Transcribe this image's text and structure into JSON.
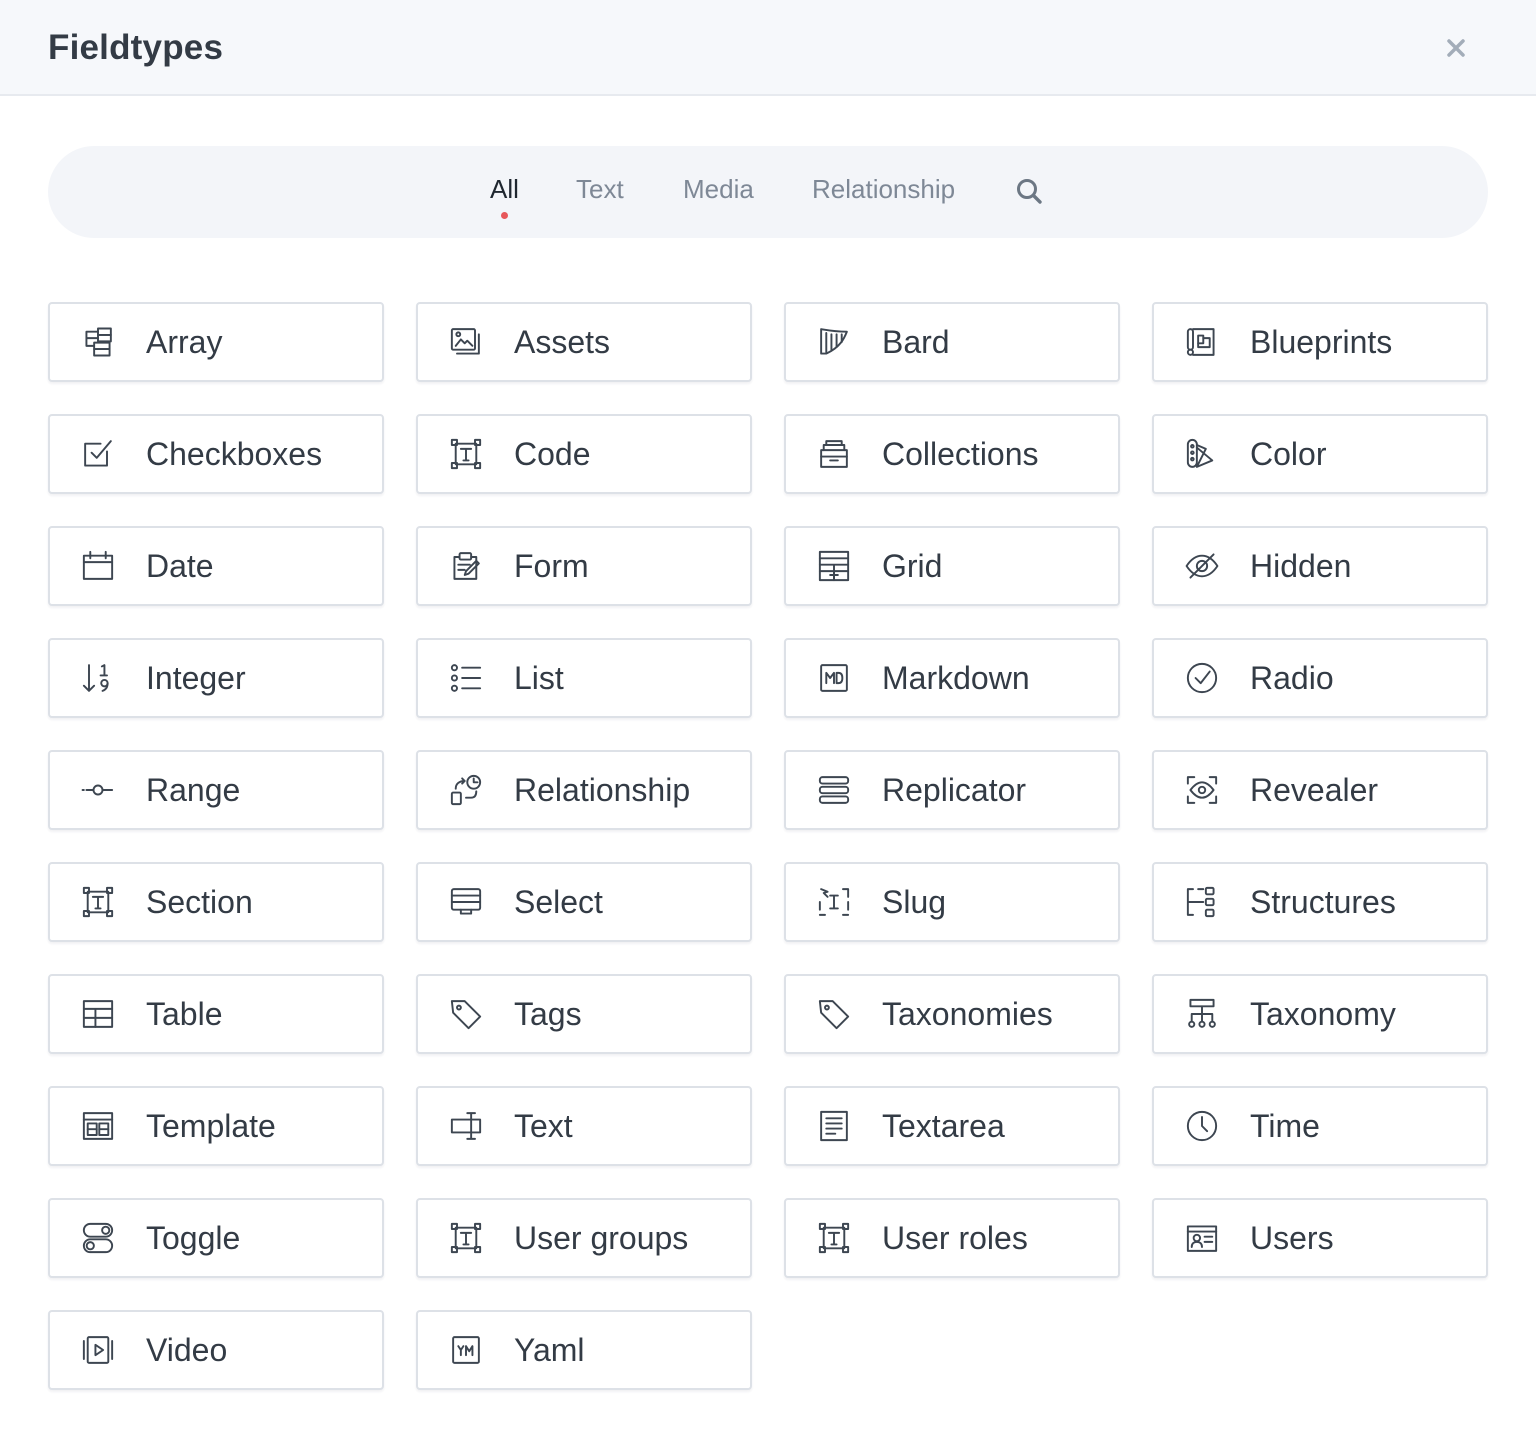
{
  "window": {
    "title": "Fieldtypes",
    "close_icon": "close-icon"
  },
  "tabs": [
    {
      "label": "All",
      "active": true
    },
    {
      "label": "Text",
      "active": false
    },
    {
      "label": "Media",
      "active": false
    },
    {
      "label": "Relationship",
      "active": false
    }
  ],
  "search_icon": "search-icon",
  "colors": {
    "active_dot": "#e7575b",
    "header_bg": "#f6f8fb",
    "tabbar_bg": "#f3f5f9",
    "card_border": "#dde1e7",
    "icon_stroke": "#3d4651"
  },
  "fieldtypes": [
    {
      "label": "Array",
      "icon": "array-icon"
    },
    {
      "label": "Assets",
      "icon": "assets-icon"
    },
    {
      "label": "Bard",
      "icon": "bard-icon"
    },
    {
      "label": "Blueprints",
      "icon": "blueprints-icon"
    },
    {
      "label": "Checkboxes",
      "icon": "checkboxes-icon"
    },
    {
      "label": "Code",
      "icon": "code-icon"
    },
    {
      "label": "Collections",
      "icon": "collections-icon"
    },
    {
      "label": "Color",
      "icon": "color-icon"
    },
    {
      "label": "Date",
      "icon": "date-icon"
    },
    {
      "label": "Form",
      "icon": "form-icon"
    },
    {
      "label": "Grid",
      "icon": "grid-icon"
    },
    {
      "label": "Hidden",
      "icon": "hidden-icon"
    },
    {
      "label": "Integer",
      "icon": "integer-icon"
    },
    {
      "label": "List",
      "icon": "list-icon"
    },
    {
      "label": "Markdown",
      "icon": "markdown-icon"
    },
    {
      "label": "Radio",
      "icon": "radio-icon"
    },
    {
      "label": "Range",
      "icon": "range-icon"
    },
    {
      "label": "Relationship",
      "icon": "relationship-icon"
    },
    {
      "label": "Replicator",
      "icon": "replicator-icon"
    },
    {
      "label": "Revealer",
      "icon": "revealer-icon"
    },
    {
      "label": "Section",
      "icon": "section-icon"
    },
    {
      "label": "Select",
      "icon": "select-icon"
    },
    {
      "label": "Slug",
      "icon": "slug-icon"
    },
    {
      "label": "Structures",
      "icon": "structures-icon"
    },
    {
      "label": "Table",
      "icon": "table-icon"
    },
    {
      "label": "Tags",
      "icon": "tags-icon"
    },
    {
      "label": "Taxonomies",
      "icon": "taxonomies-icon"
    },
    {
      "label": "Taxonomy",
      "icon": "taxonomy-icon"
    },
    {
      "label": "Template",
      "icon": "template-icon"
    },
    {
      "label": "Text",
      "icon": "text-icon"
    },
    {
      "label": "Textarea",
      "icon": "textarea-icon"
    },
    {
      "label": "Time",
      "icon": "time-icon"
    },
    {
      "label": "Toggle",
      "icon": "toggle-icon"
    },
    {
      "label": "User groups",
      "icon": "user-groups-icon"
    },
    {
      "label": "User roles",
      "icon": "user-roles-icon"
    },
    {
      "label": "Users",
      "icon": "users-icon"
    },
    {
      "label": "Video",
      "icon": "video-icon"
    },
    {
      "label": "Yaml",
      "icon": "yaml-icon"
    }
  ]
}
